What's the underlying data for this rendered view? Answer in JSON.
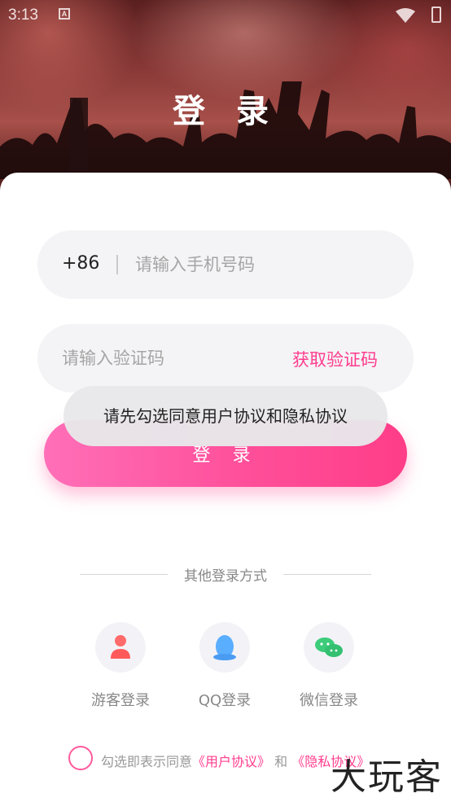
{
  "status": {
    "time": "3:13",
    "notif": "A"
  },
  "header": {
    "title": "登 录"
  },
  "phone": {
    "country_code": "+86",
    "placeholder": "请输入手机号码"
  },
  "code": {
    "placeholder": "请输入验证码",
    "get_code": "获取验证码"
  },
  "login_button": "登 录",
  "toast": "请先勾选同意用户协议和隐私协议",
  "other": {
    "title": "其他登录方式",
    "options": [
      {
        "label": "游客登录",
        "icon": "user-icon"
      },
      {
        "label": "QQ登录",
        "icon": "qq-icon"
      },
      {
        "label": "微信登录",
        "icon": "wechat-icon"
      }
    ]
  },
  "agreement": {
    "prefix": "勾选即表示同意",
    "user": "《用户协议》",
    "and": "和",
    "privacy": "《隐私协议》"
  },
  "watermark": "大玩客",
  "colors": {
    "accent": "#ff3c8e"
  }
}
